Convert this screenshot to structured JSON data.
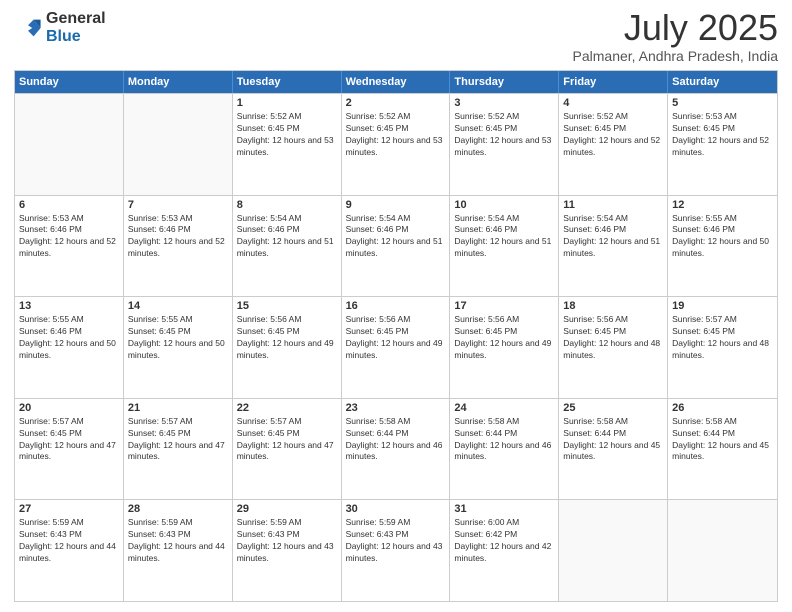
{
  "header": {
    "logo_general": "General",
    "logo_blue": "Blue",
    "title": "July 2025",
    "location": "Palmaner, Andhra Pradesh, India"
  },
  "calendar": {
    "days_of_week": [
      "Sunday",
      "Monday",
      "Tuesday",
      "Wednesday",
      "Thursday",
      "Friday",
      "Saturday"
    ],
    "rows": [
      [
        {
          "day": "",
          "empty": true
        },
        {
          "day": "",
          "empty": true
        },
        {
          "day": "1",
          "sunrise": "Sunrise: 5:52 AM",
          "sunset": "Sunset: 6:45 PM",
          "daylight": "Daylight: 12 hours and 53 minutes."
        },
        {
          "day": "2",
          "sunrise": "Sunrise: 5:52 AM",
          "sunset": "Sunset: 6:45 PM",
          "daylight": "Daylight: 12 hours and 53 minutes."
        },
        {
          "day": "3",
          "sunrise": "Sunrise: 5:52 AM",
          "sunset": "Sunset: 6:45 PM",
          "daylight": "Daylight: 12 hours and 53 minutes."
        },
        {
          "day": "4",
          "sunrise": "Sunrise: 5:52 AM",
          "sunset": "Sunset: 6:45 PM",
          "daylight": "Daylight: 12 hours and 52 minutes."
        },
        {
          "day": "5",
          "sunrise": "Sunrise: 5:53 AM",
          "sunset": "Sunset: 6:45 PM",
          "daylight": "Daylight: 12 hours and 52 minutes."
        }
      ],
      [
        {
          "day": "6",
          "sunrise": "Sunrise: 5:53 AM",
          "sunset": "Sunset: 6:46 PM",
          "daylight": "Daylight: 12 hours and 52 minutes."
        },
        {
          "day": "7",
          "sunrise": "Sunrise: 5:53 AM",
          "sunset": "Sunset: 6:46 PM",
          "daylight": "Daylight: 12 hours and 52 minutes."
        },
        {
          "day": "8",
          "sunrise": "Sunrise: 5:54 AM",
          "sunset": "Sunset: 6:46 PM",
          "daylight": "Daylight: 12 hours and 51 minutes."
        },
        {
          "day": "9",
          "sunrise": "Sunrise: 5:54 AM",
          "sunset": "Sunset: 6:46 PM",
          "daylight": "Daylight: 12 hours and 51 minutes."
        },
        {
          "day": "10",
          "sunrise": "Sunrise: 5:54 AM",
          "sunset": "Sunset: 6:46 PM",
          "daylight": "Daylight: 12 hours and 51 minutes."
        },
        {
          "day": "11",
          "sunrise": "Sunrise: 5:54 AM",
          "sunset": "Sunset: 6:46 PM",
          "daylight": "Daylight: 12 hours and 51 minutes."
        },
        {
          "day": "12",
          "sunrise": "Sunrise: 5:55 AM",
          "sunset": "Sunset: 6:46 PM",
          "daylight": "Daylight: 12 hours and 50 minutes."
        }
      ],
      [
        {
          "day": "13",
          "sunrise": "Sunrise: 5:55 AM",
          "sunset": "Sunset: 6:46 PM",
          "daylight": "Daylight: 12 hours and 50 minutes."
        },
        {
          "day": "14",
          "sunrise": "Sunrise: 5:55 AM",
          "sunset": "Sunset: 6:45 PM",
          "daylight": "Daylight: 12 hours and 50 minutes."
        },
        {
          "day": "15",
          "sunrise": "Sunrise: 5:56 AM",
          "sunset": "Sunset: 6:45 PM",
          "daylight": "Daylight: 12 hours and 49 minutes."
        },
        {
          "day": "16",
          "sunrise": "Sunrise: 5:56 AM",
          "sunset": "Sunset: 6:45 PM",
          "daylight": "Daylight: 12 hours and 49 minutes."
        },
        {
          "day": "17",
          "sunrise": "Sunrise: 5:56 AM",
          "sunset": "Sunset: 6:45 PM",
          "daylight": "Daylight: 12 hours and 49 minutes."
        },
        {
          "day": "18",
          "sunrise": "Sunrise: 5:56 AM",
          "sunset": "Sunset: 6:45 PM",
          "daylight": "Daylight: 12 hours and 48 minutes."
        },
        {
          "day": "19",
          "sunrise": "Sunrise: 5:57 AM",
          "sunset": "Sunset: 6:45 PM",
          "daylight": "Daylight: 12 hours and 48 minutes."
        }
      ],
      [
        {
          "day": "20",
          "sunrise": "Sunrise: 5:57 AM",
          "sunset": "Sunset: 6:45 PM",
          "daylight": "Daylight: 12 hours and 47 minutes."
        },
        {
          "day": "21",
          "sunrise": "Sunrise: 5:57 AM",
          "sunset": "Sunset: 6:45 PM",
          "daylight": "Daylight: 12 hours and 47 minutes."
        },
        {
          "day": "22",
          "sunrise": "Sunrise: 5:57 AM",
          "sunset": "Sunset: 6:45 PM",
          "daylight": "Daylight: 12 hours and 47 minutes."
        },
        {
          "day": "23",
          "sunrise": "Sunrise: 5:58 AM",
          "sunset": "Sunset: 6:44 PM",
          "daylight": "Daylight: 12 hours and 46 minutes."
        },
        {
          "day": "24",
          "sunrise": "Sunrise: 5:58 AM",
          "sunset": "Sunset: 6:44 PM",
          "daylight": "Daylight: 12 hours and 46 minutes."
        },
        {
          "day": "25",
          "sunrise": "Sunrise: 5:58 AM",
          "sunset": "Sunset: 6:44 PM",
          "daylight": "Daylight: 12 hours and 45 minutes."
        },
        {
          "day": "26",
          "sunrise": "Sunrise: 5:58 AM",
          "sunset": "Sunset: 6:44 PM",
          "daylight": "Daylight: 12 hours and 45 minutes."
        }
      ],
      [
        {
          "day": "27",
          "sunrise": "Sunrise: 5:59 AM",
          "sunset": "Sunset: 6:43 PM",
          "daylight": "Daylight: 12 hours and 44 minutes."
        },
        {
          "day": "28",
          "sunrise": "Sunrise: 5:59 AM",
          "sunset": "Sunset: 6:43 PM",
          "daylight": "Daylight: 12 hours and 44 minutes."
        },
        {
          "day": "29",
          "sunrise": "Sunrise: 5:59 AM",
          "sunset": "Sunset: 6:43 PM",
          "daylight": "Daylight: 12 hours and 43 minutes."
        },
        {
          "day": "30",
          "sunrise": "Sunrise: 5:59 AM",
          "sunset": "Sunset: 6:43 PM",
          "daylight": "Daylight: 12 hours and 43 minutes."
        },
        {
          "day": "31",
          "sunrise": "Sunrise: 6:00 AM",
          "sunset": "Sunset: 6:42 PM",
          "daylight": "Daylight: 12 hours and 42 minutes."
        },
        {
          "day": "",
          "empty": true
        },
        {
          "day": "",
          "empty": true
        }
      ]
    ]
  }
}
